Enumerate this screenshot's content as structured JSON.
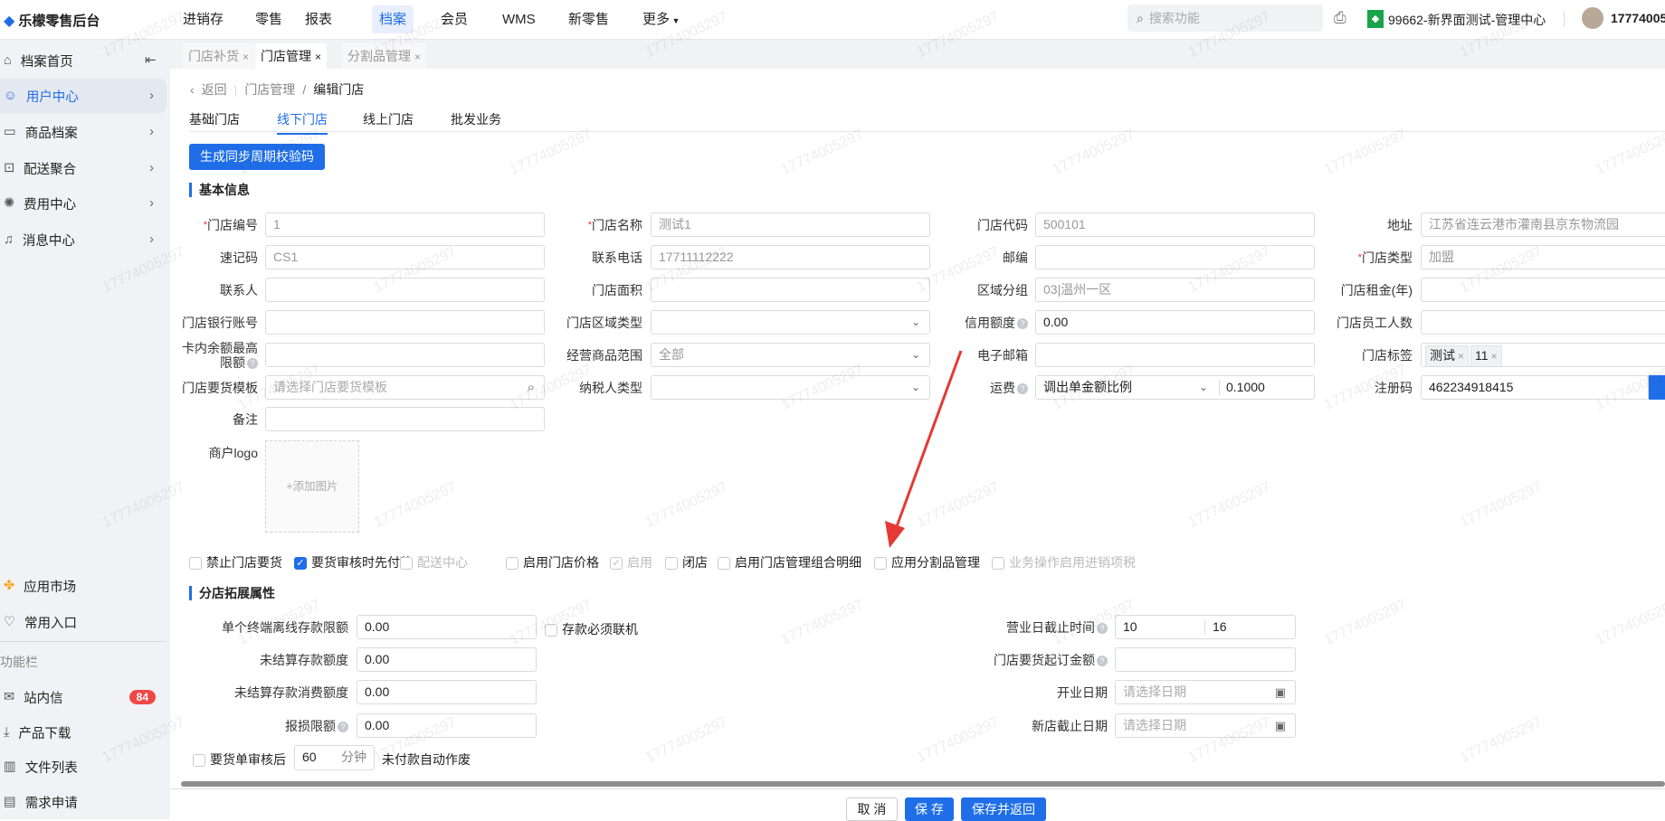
{
  "app_title": "乐檬零售后台",
  "watermark": "17774005297",
  "top_nav": [
    "进销存",
    "零售",
    "报表",
    "档案",
    "会员",
    "WMS",
    "新零售",
    "更多"
  ],
  "top_nav_active": "档案",
  "search_placeholder": "搜索功能",
  "org_name": "99662-新界面测试-管理中心",
  "user_name": "17774005",
  "sidebar": {
    "items": [
      {
        "label": "档案首页",
        "icon": "home-icon"
      },
      {
        "label": "用户中心",
        "icon": "user-icon",
        "active": true
      },
      {
        "label": "商品档案",
        "icon": "box-icon"
      },
      {
        "label": "配送聚合",
        "icon": "map-icon"
      },
      {
        "label": "费用中心",
        "icon": "money-icon"
      },
      {
        "label": "消息中心",
        "icon": "bell-icon"
      }
    ],
    "bottom": [
      {
        "label": "应用市场",
        "icon": "app-market-icon"
      },
      {
        "label": "常用入口",
        "icon": "heart-icon"
      }
    ],
    "section_label": "功能栏",
    "tools": [
      {
        "label": "站内信",
        "icon": "mail-icon",
        "badge": "84"
      },
      {
        "label": "产品下载",
        "icon": "download-icon"
      },
      {
        "label": "文件列表",
        "icon": "chart-file-icon"
      },
      {
        "label": "需求申请",
        "icon": "message-icon"
      }
    ]
  },
  "tabs": [
    {
      "label": "门店补货"
    },
    {
      "label": "门店管理",
      "active": true
    },
    {
      "label": "分割品管理"
    }
  ],
  "breadcrumb": {
    "back": "返回",
    "parent": "门店管理",
    "current": "编辑门店"
  },
  "subtabs": [
    "基础门店",
    "线下门店",
    "线上门店",
    "批发业务"
  ],
  "subtab_active": 1,
  "gen_button": "生成同步周期校验码",
  "section_basic": "基本信息",
  "form_rows": [
    [
      {
        "label": "门店编号",
        "req": true,
        "value": "1",
        "grey": true
      },
      {
        "label": "门店名称",
        "req": true,
        "value": "测试1",
        "grey": true
      },
      {
        "label": "门店代码",
        "value": "500101",
        "grey": true
      },
      {
        "label": "地址",
        "value": "江苏省连云港市灌南县京东物流园",
        "grey": true
      }
    ],
    [
      {
        "label": "速记码",
        "value": "CS1",
        "grey": true
      },
      {
        "label": "联系电话",
        "value": "17711112222",
        "grey": true
      },
      {
        "label": "邮编",
        "value": ""
      },
      {
        "label": "门店类型",
        "req": true,
        "value": "加盟",
        "grey": true
      }
    ],
    [
      {
        "label": "联系人",
        "value": ""
      },
      {
        "label": "门店面积",
        "value": ""
      },
      {
        "label": "区域分组",
        "value": "03|温州一区",
        "grey": true
      },
      {
        "label": "门店租金(年)",
        "value": ""
      }
    ],
    [
      {
        "label": "门店银行账号",
        "value": ""
      },
      {
        "label": "门店区域类型",
        "type": "select",
        "value": ""
      },
      {
        "label": "信用额度",
        "help": true,
        "value": "0.00"
      },
      {
        "label": "门店员工人数",
        "value": ""
      }
    ],
    [
      {
        "label": "卡内余额最高",
        "label2": "限额",
        "help": true,
        "value": ""
      },
      {
        "label": "经营商品范围",
        "type": "select",
        "value": "全部",
        "grey": true
      },
      {
        "label": "电子邮箱",
        "value": ""
      },
      {
        "label": "门店标签",
        "type": "tags",
        "tags": [
          "测试",
          "11"
        ]
      }
    ],
    [
      {
        "label": "门店要货模板",
        "type": "search",
        "placeholder": "请选择门店要货模板"
      },
      {
        "label": "纳税人类型",
        "type": "select",
        "value": ""
      },
      {
        "label": "运费",
        "help": true,
        "type": "compound",
        "value": "调出单金额比例",
        "value2": "0.1000"
      },
      {
        "label": "注册码",
        "value": "462234918415",
        "suffix_button": true
      }
    ],
    [
      {
        "label": "备注",
        "value": ""
      }
    ]
  ],
  "logo_label": "商户logo",
  "logo_add": "+添加图片",
  "checkboxes": [
    {
      "label": "禁止门店要货",
      "checked": false
    },
    {
      "label": "要货审核时先付款",
      "checked": true
    },
    {
      "label": "配送中心",
      "checked": false,
      "disabled": true
    },
    {
      "label": "启用门店价格",
      "checked": false
    },
    {
      "label": "启用",
      "checked": true,
      "disabled": true
    },
    {
      "label": "闭店",
      "checked": false
    },
    {
      "label": "启用门店管理组合明细",
      "checked": false
    },
    {
      "label": "应用分割品管理",
      "checked": false
    },
    {
      "label": "业务操作启用进销项税",
      "checked": false,
      "disabled": true
    }
  ],
  "section_ext": "分店拓展属性",
  "ext_left": [
    {
      "label": "单个终端离线存款限额",
      "value": "0.00"
    },
    {
      "label": "未结算存款额度",
      "value": "0.00"
    },
    {
      "label": "未结算存款消费额度",
      "value": "0.00"
    },
    {
      "label": "报损限额",
      "value": "0.00",
      "help": true
    }
  ],
  "deposit_online": "存款必须联机",
  "ext_right": [
    {
      "label": "营业日截止时间",
      "help": true,
      "value": "10",
      "value2": "16"
    },
    {
      "label": "门店要货起订金额",
      "help": true,
      "value": ""
    },
    {
      "label": "开业日期",
      "placeholder": "请选择日期",
      "date": true
    },
    {
      "label": "新店截止日期",
      "placeholder": "请选择日期",
      "date": true
    }
  ],
  "auto_void": {
    "pre": "要货单审核后",
    "value": "60",
    "unit": "分钟",
    "post": "未付款自动作废"
  },
  "footer": {
    "cancel": "取 消",
    "save": "保 存",
    "save_return": "保存并返回"
  },
  "colors": {
    "accent": "#1f6ee8",
    "badge": "#f04848",
    "arrow": "#e53935"
  }
}
